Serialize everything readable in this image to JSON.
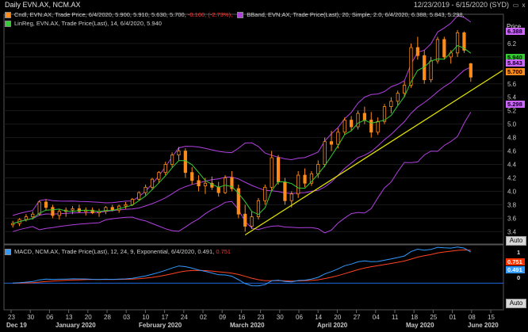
{
  "window": {
    "title": "Daily EVN.AX, NCM.AX",
    "date_range": "12/23/2019 - 6/15/2020 (SYD)"
  },
  "legend": {
    "candle": {
      "label": "Cndl, EVN.AX, Trade Price, 6/4/2020, 5.900, 5.910, 5.630, 5.700,",
      "change": "-0.160, (-2.73%),"
    },
    "bband": "BBand, EVN.AX, Trade Price(Last), 20, Simple, 2.0, 6/4/2020, 6.388, 5.843, 5.298,",
    "linreg": "LinReg, EVN.AX, Trade Price(Last), 14, 6/4/2020, 5.940",
    "macd": "MACD, NCM.AX, Trade Price(Last), 12, 24, 9, Exponential, 6/4/2020, 0.491,",
    "macd_value": "0.751"
  },
  "price_axis": {
    "label": "Price",
    "ticks": [
      "6.2",
      "6.0",
      "5.6",
      "5.4",
      "5.2",
      "5.0",
      "4.8",
      "4.6",
      "4.4",
      "4.2",
      "4.0",
      "3.8",
      "3.6",
      "3.4"
    ]
  },
  "price_badges": [
    {
      "text": "6.388",
      "bg": "#cc66ff",
      "price": 6.388
    },
    {
      "text": "5.940",
      "bg": "#33cc33",
      "price": 6.0
    },
    {
      "text": "5.843",
      "bg": "#cc66ff",
      "price": 5.92
    },
    {
      "text": "5.700",
      "bg": "#ff8c1a",
      "price": 5.79
    },
    {
      "text": "5.298",
      "bg": "#cc66ff",
      "price": 5.298
    }
  ],
  "macd_axis": {
    "ticks": [
      "1",
      "0"
    ]
  },
  "macd_badges": [
    {
      "text": "0.751",
      "bg": "#ff3300"
    },
    {
      "text": "0.491",
      "bg": "#3399ff"
    }
  ],
  "buttons": {
    "auto_top": "Auto",
    "auto_bottom": "Auto",
    "close": "x",
    "restore": "▭"
  },
  "x_axis": {
    "days": [
      "23",
      "30",
      "06",
      "13",
      "20",
      "28",
      "03",
      "10",
      "17",
      "24",
      "02",
      "09",
      "16",
      "23",
      "30",
      "06",
      "14",
      "20",
      "27",
      "04",
      "11",
      "18",
      "25",
      "01",
      "08",
      "15"
    ],
    "months": [
      "Dec 19",
      "January 2020",
      "February 2020",
      "March 2020",
      "April 2020",
      "May 2020",
      "June 2020"
    ]
  },
  "colors": {
    "candle_up": "#ff8c1a",
    "candle_down": "#ff8c1a",
    "bband": "#b040e0",
    "linreg": "#33cc33",
    "trendline": "#e6e600",
    "macd": "#3399ff",
    "signal": "#ff4422"
  },
  "chart_data": {
    "type": "line",
    "candles": [
      [
        3.5,
        3.56,
        3.46,
        3.52
      ],
      [
        3.52,
        3.6,
        3.48,
        3.58
      ],
      [
        3.58,
        3.66,
        3.55,
        3.62
      ],
      [
        3.62,
        3.7,
        3.58,
        3.66
      ],
      [
        3.66,
        3.86,
        3.64,
        3.84
      ],
      [
        3.84,
        3.88,
        3.72,
        3.76
      ],
      [
        3.76,
        3.8,
        3.6,
        3.64
      ],
      [
        3.64,
        3.74,
        3.58,
        3.7
      ],
      [
        3.7,
        3.76,
        3.62,
        3.72
      ],
      [
        3.72,
        3.78,
        3.66,
        3.74
      ],
      [
        3.74,
        3.8,
        3.68,
        3.7
      ],
      [
        3.7,
        3.76,
        3.64,
        3.72
      ],
      [
        3.72,
        3.76,
        3.66,
        3.68
      ],
      [
        3.68,
        3.74,
        3.62,
        3.7
      ],
      [
        3.7,
        3.78,
        3.66,
        3.76
      ],
      [
        3.76,
        3.8,
        3.7,
        3.72
      ],
      [
        3.72,
        3.8,
        3.68,
        3.78
      ],
      [
        3.78,
        3.84,
        3.74,
        3.8
      ],
      [
        3.8,
        3.9,
        3.78,
        3.88
      ],
      [
        3.88,
        4.0,
        3.86,
        3.98
      ],
      [
        3.98,
        4.1,
        3.94,
        4.06
      ],
      [
        4.06,
        4.2,
        4.02,
        4.18
      ],
      [
        4.18,
        4.3,
        4.12,
        4.28
      ],
      [
        4.28,
        4.44,
        4.24,
        4.4
      ],
      [
        4.4,
        4.58,
        4.36,
        4.54
      ],
      [
        4.54,
        4.66,
        4.46,
        4.6
      ],
      [
        4.6,
        4.64,
        4.2,
        4.28
      ],
      [
        4.28,
        4.36,
        4.1,
        4.16
      ],
      [
        4.16,
        4.24,
        4.0,
        4.08
      ],
      [
        4.08,
        4.2,
        3.96,
        4.12
      ],
      [
        4.12,
        4.22,
        4.02,
        4.06
      ],
      [
        4.06,
        4.14,
        3.92,
        3.98
      ],
      [
        3.98,
        4.24,
        3.96,
        4.2
      ],
      [
        4.2,
        4.3,
        4.0,
        4.04
      ],
      [
        4.04,
        4.1,
        3.6,
        3.66
      ],
      [
        3.66,
        3.8,
        3.4,
        3.48
      ],
      [
        3.48,
        3.7,
        3.44,
        3.62
      ],
      [
        3.62,
        3.9,
        3.58,
        3.86
      ],
      [
        3.86,
        4.1,
        3.8,
        4.06
      ],
      [
        4.06,
        4.6,
        4.0,
        4.5
      ],
      [
        4.5,
        4.54,
        4.1,
        4.14
      ],
      [
        4.14,
        4.2,
        3.8,
        3.86
      ],
      [
        3.86,
        4.0,
        3.76,
        3.96
      ],
      [
        3.96,
        4.3,
        3.9,
        4.24
      ],
      [
        4.24,
        4.34,
        4.06,
        4.12
      ],
      [
        4.12,
        4.3,
        4.08,
        4.26
      ],
      [
        4.26,
        4.46,
        4.2,
        4.4
      ],
      [
        4.4,
        4.8,
        4.36,
        4.74
      ],
      [
        4.74,
        4.9,
        4.6,
        4.7
      ],
      [
        4.7,
        4.94,
        4.64,
        4.88
      ],
      [
        4.88,
        5.1,
        4.84,
        5.06
      ],
      [
        5.06,
        5.12,
        4.9,
        4.96
      ],
      [
        4.96,
        5.2,
        4.92,
        5.16
      ],
      [
        5.16,
        5.26,
        5.0,
        5.06
      ],
      [
        5.06,
        5.18,
        4.8,
        4.88
      ],
      [
        4.88,
        5.1,
        4.84,
        5.04
      ],
      [
        5.04,
        5.3,
        5.0,
        5.26
      ],
      [
        5.26,
        5.4,
        5.16,
        5.34
      ],
      [
        5.34,
        5.5,
        5.28,
        5.46
      ],
      [
        5.46,
        5.64,
        5.4,
        5.58
      ],
      [
        5.58,
        6.2,
        5.54,
        6.14
      ],
      [
        6.14,
        6.3,
        5.96,
        6.02
      ],
      [
        6.02,
        6.1,
        5.6,
        5.66
      ],
      [
        5.66,
        6.0,
        5.62,
        5.94
      ],
      [
        5.94,
        6.3,
        5.9,
        6.26
      ],
      [
        6.26,
        6.3,
        5.96,
        6.0
      ],
      [
        6.0,
        6.1,
        5.9,
        6.06
      ],
      [
        6.06,
        6.4,
        6.0,
        6.36
      ],
      [
        6.36,
        6.38,
        6.06,
        6.1
      ],
      [
        5.9,
        5.91,
        5.63,
        5.7
      ]
    ]
  }
}
